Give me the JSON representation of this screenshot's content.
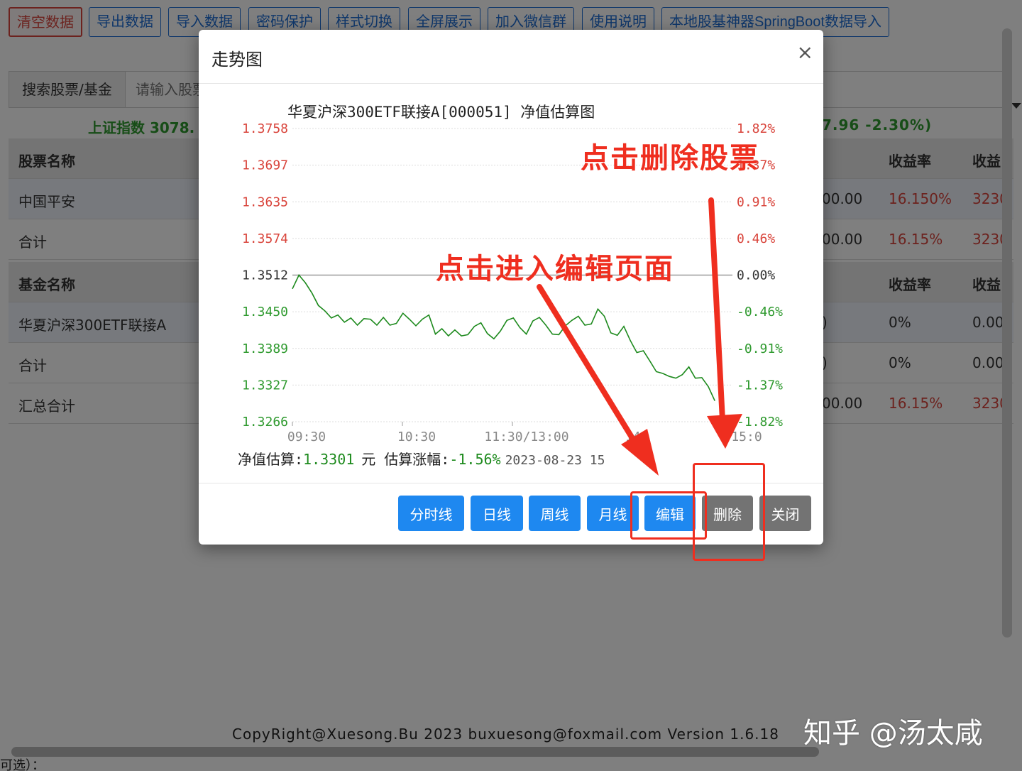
{
  "toolbar": {
    "buttons": [
      {
        "label": "清空数据",
        "danger": true
      },
      {
        "label": "导出数据"
      },
      {
        "label": "导入数据"
      },
      {
        "label": "密码保护"
      },
      {
        "label": "样式切换"
      },
      {
        "label": "全屏展示"
      },
      {
        "label": "加入微信群"
      },
      {
        "label": "使用说明"
      },
      {
        "label": "本地股基神器SpringBoot数据导入"
      }
    ]
  },
  "search": {
    "label": "搜索股票/基金",
    "placeholder": "请输入股票"
  },
  "index_bar": {
    "left": "上证指数 3078.",
    "right": "7.96  -2.30%)"
  },
  "stock_table": {
    "header": [
      "股票名称",
      "收益率",
      "收益"
    ],
    "rows": [
      {
        "name": "中国平安",
        "amount": "00.00",
        "rate": "16.150%",
        "profit": "3230"
      },
      {
        "name": "合计",
        "amount": "00.00",
        "rate": "16.15%",
        "profit": "3230"
      }
    ]
  },
  "fund_table": {
    "header": [
      "基金名称",
      "收益率",
      "收益"
    ],
    "rows": [
      {
        "name": "华夏沪深300ETF联接A",
        "amount": ")",
        "rate": "0%",
        "profit": "0.00"
      },
      {
        "name": "合计",
        "amount": ")",
        "rate": "0%",
        "profit": "0.00"
      }
    ]
  },
  "total_row": {
    "name": "汇总合计",
    "amount": "00.00",
    "rate": "16.15%",
    "profit": "3230"
  },
  "copyright": "CopyRight@Xuesong.Bu 2023 buxuesong@foxmail.com Version 1.6.18",
  "footer_hint": "可选）：",
  "modal": {
    "title": "走势图",
    "close": "×",
    "buttons": {
      "minute": "分时线",
      "daily": "日线",
      "weekly": "周线",
      "monthly": "月线",
      "edit": "编辑",
      "delete": "删除",
      "close": "关闭"
    }
  },
  "annotations": {
    "delete": "点击删除股票",
    "edit": "点击进入编辑页面"
  },
  "watermark": "知乎 @汤太咸",
  "colors": {
    "up": "#d9453c",
    "down": "#2f9a2f",
    "primary": "#1e88f0",
    "annotation": "#ef2e1f"
  },
  "chart_data": {
    "type": "line",
    "title": "华夏沪深300ETF联接A[000051] 净值估算图",
    "base_value": 1.3512,
    "y_ticks_left": [
      "1.3758",
      "1.3697",
      "1.3635",
      "1.3574",
      "1.3512",
      "1.3450",
      "1.3389",
      "1.3327",
      "1.3266"
    ],
    "y_ticks_right": [
      "1.82%",
      "1.37%",
      "0.91%",
      "0.46%",
      "0.00%",
      "-0.46%",
      "-0.91%",
      "-1.37%",
      "-1.82%"
    ],
    "x_ticks": [
      "09:30",
      "10:30",
      "11:30/13:00",
      "14:",
      "15:0"
    ],
    "ylim": [
      1.3266,
      1.3758
    ],
    "series": [
      {
        "values": [
          1.3489,
          1.3512,
          1.3499,
          1.3482,
          1.3461,
          1.3452,
          1.344,
          1.3445,
          1.3433,
          1.344,
          1.3428,
          1.3439,
          1.3438,
          1.3428,
          1.3441,
          1.3428,
          1.3431,
          1.3448,
          1.3438,
          1.3427,
          1.3438,
          1.3445,
          1.3413,
          1.3422,
          1.341,
          1.342,
          1.341,
          1.3412,
          1.3426,
          1.3432,
          1.3414,
          1.3405,
          1.3418,
          1.3436,
          1.344,
          1.3424,
          1.3413,
          1.3435,
          1.3441,
          1.3428,
          1.3413,
          1.3412,
          1.3427,
          1.3436,
          1.3443,
          1.3428,
          1.343,
          1.3455,
          1.3443,
          1.3415,
          1.3411,
          1.3426,
          1.3402,
          1.3382,
          1.3385,
          1.3368,
          1.335,
          1.3347,
          1.3342,
          1.3339,
          1.3345,
          1.3358,
          1.3339,
          1.334,
          1.3325,
          1.3301
        ]
      }
    ]
  },
  "chart_footer": {
    "nav_label": "净值估算:",
    "nav_value": "1.3301",
    "nav_unit": "元",
    "change_label": "估算涨幅:",
    "change_value": "-1.56%",
    "time": "2023-08-23 15"
  }
}
